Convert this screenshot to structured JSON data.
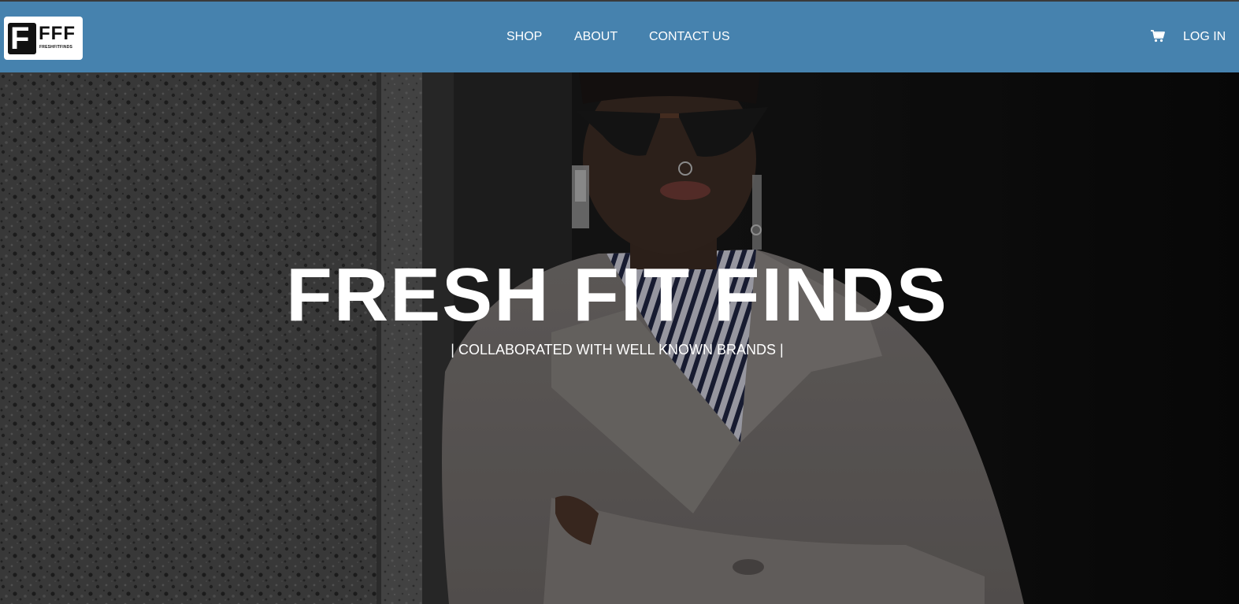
{
  "brand": {
    "logo_letter": "F",
    "logo_text": "FFF",
    "logo_subtitle": "FRESHFITFINDS"
  },
  "nav": {
    "items": [
      {
        "label": "SHOP"
      },
      {
        "label": "ABOUT"
      },
      {
        "label": "CONTACT US"
      }
    ],
    "cart_icon": "shopping-cart-icon",
    "login_label": "LOG IN"
  },
  "hero": {
    "title": "FRESH FIT FINDS",
    "subtitle": "| COLLABORATED WITH WELL KNOWN BRANDS |"
  },
  "colors": {
    "navbar": "#4682ae",
    "text": "#ffffff"
  }
}
